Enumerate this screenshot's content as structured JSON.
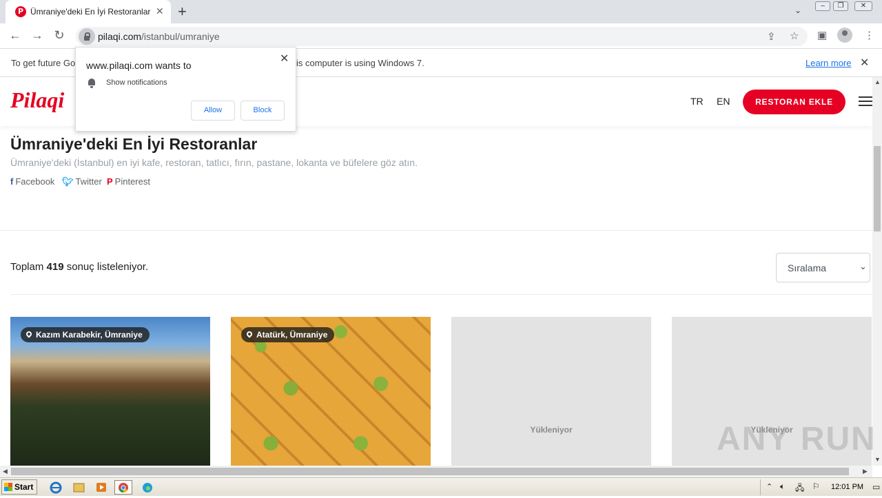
{
  "browser": {
    "tab_title": "Ümraniye'deki En İyi Restoranlar - İs",
    "tab_favicon": "P",
    "url_host": "pilaqi.com",
    "url_path": "/istanbul/umraniye"
  },
  "infobar": {
    "text_left": "To get future Go",
    "text_right": "is computer is using Windows 7.",
    "learn_more": "Learn more"
  },
  "popup": {
    "title": "www.pilaqi.com wants to",
    "permission": "Show notifications",
    "allow": "Allow",
    "block": "Block"
  },
  "site": {
    "logo": "Pilaqi",
    "lang_tr": "TR",
    "lang_en": "EN",
    "add_button": "RESTORAN EKLE"
  },
  "main": {
    "title": "Ümraniye'deki En İyi Restoranlar",
    "subtitle": "Ümraniye'deki (İstanbul) en iyi kafe, restoran, tatlıcı, fırın, pastane, lokanta ve büfelere göz atın.",
    "social": {
      "facebook": "Facebook",
      "twitter": "Twitter",
      "pinterest": "Pinterest"
    },
    "count_prefix": "Toplam ",
    "count_value": "419",
    "count_suffix": " sonuç listeleniyor.",
    "sort_label": "Sıralama"
  },
  "cards": [
    {
      "location": "Kazım Karabekir, Ümraniye"
    },
    {
      "location": "Atatürk, Ümraniye"
    },
    {
      "loading": "Yükleniyor"
    },
    {
      "loading": "Yükleniyor"
    }
  ],
  "taskbar": {
    "start": "Start",
    "clock": "12:01 PM"
  },
  "watermark": "ANY RUN"
}
